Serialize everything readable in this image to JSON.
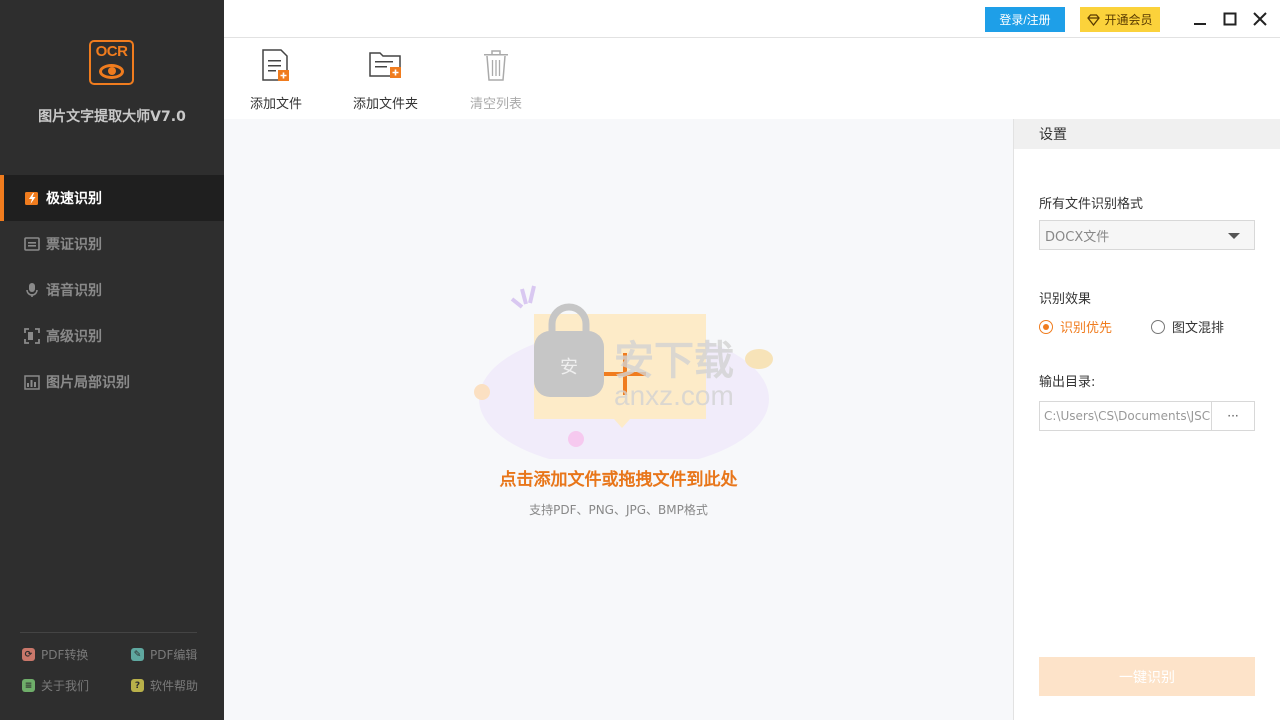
{
  "app": {
    "logo_text": "OCR",
    "title": "图片文字提取大师V7.0"
  },
  "sidebar": {
    "items": [
      {
        "label": "极速识别",
        "icon": "lightning-pen-icon",
        "active": true
      },
      {
        "label": "票证识别",
        "icon": "ticket-icon",
        "active": false
      },
      {
        "label": "语音识别",
        "icon": "microphone-icon",
        "active": false
      },
      {
        "label": "高级识别",
        "icon": "scan-bracket-icon",
        "active": false
      },
      {
        "label": "图片局部识别",
        "icon": "image-chart-icon",
        "active": false
      }
    ],
    "footer": [
      {
        "label": "PDF转换",
        "icon": "pdf-convert-icon",
        "color": "#c9776a"
      },
      {
        "label": "PDF编辑",
        "icon": "pdf-edit-icon",
        "color": "#5fa8a0"
      },
      {
        "label": "关于我们",
        "icon": "about-icon",
        "color": "#6fae6a"
      },
      {
        "label": "软件帮助",
        "icon": "help-icon",
        "color": "#b9b14a"
      }
    ]
  },
  "topbar": {
    "login_label": "登录/注册",
    "vip_label": "开通会员"
  },
  "toolbar": {
    "add_file": "添加文件",
    "add_folder": "添加文件夹",
    "clear_list": "清空列表"
  },
  "drop_area": {
    "title": "点击添加文件或拖拽文件到此处",
    "subtitle": "支持PDF、PNG、JPG、BMP格式"
  },
  "settings": {
    "header": "设置",
    "format_label": "所有文件识别格式",
    "format_value": "DOCX文件",
    "effect_label": "识别效果",
    "effect_options": [
      {
        "label": "识别优先",
        "checked": true
      },
      {
        "label": "图文混排",
        "checked": false
      }
    ],
    "output_label": "输出目录:",
    "output_path": "C:\\Users\\CS\\Documents\\JSC",
    "browse_label": "···",
    "recognize_button": "一键识别"
  },
  "colors": {
    "accent": "#f07c1e",
    "sidebar_bg": "#2e2e2e",
    "login_blue": "#1e9fe8",
    "vip_yellow": "#fbd23b"
  }
}
